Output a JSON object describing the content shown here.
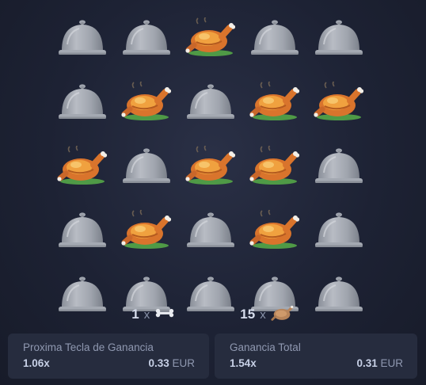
{
  "board": {
    "rows": [
      [
        "cloche",
        "cloche",
        "chicken",
        "cloche",
        "cloche"
      ],
      [
        "cloche",
        "chicken",
        "cloche",
        "chicken",
        "chicken"
      ],
      [
        "chicken",
        "cloche",
        "chicken",
        "chicken",
        "cloche"
      ],
      [
        "cloche",
        "chicken",
        "cloche",
        "chicken",
        "cloche"
      ],
      [
        "cloche",
        "cloche",
        "cloche",
        "cloche",
        "cloche"
      ]
    ]
  },
  "counters": {
    "bones": {
      "count": "1",
      "x": "x",
      "icon": "bone-icon"
    },
    "chickens": {
      "count": "15",
      "x": "x",
      "icon": "chicken-icon"
    }
  },
  "next_win": {
    "label": "Proxima Tecla de Ganancia",
    "multiplier": "1.06x",
    "amount": "0.33",
    "currency": "EUR"
  },
  "total_win": {
    "label": "Ganancia Total",
    "multiplier": "1.54x",
    "amount": "0.31",
    "currency": "EUR"
  },
  "colors": {
    "background": "#1d2234",
    "panel": "#262c3e",
    "cloche": "#9ea3ad",
    "chicken": "#e8923a"
  }
}
